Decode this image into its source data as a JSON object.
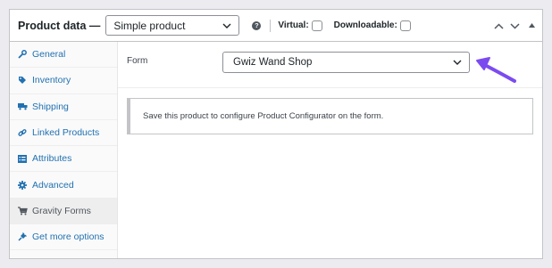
{
  "header": {
    "title": "Product data —",
    "product_type": "Simple product",
    "help_icon": "help-question-icon",
    "virtual_label": "Virtual:",
    "downloadable_label": "Downloadable:"
  },
  "sidebar": {
    "items": [
      {
        "label": "General",
        "icon": "wrench-icon"
      },
      {
        "label": "Inventory",
        "icon": "tag-icon"
      },
      {
        "label": "Shipping",
        "icon": "truck-icon"
      },
      {
        "label": "Linked Products",
        "icon": "link-icon"
      },
      {
        "label": "Attributes",
        "icon": "list-table-icon"
      },
      {
        "label": "Advanced",
        "icon": "gear-icon"
      },
      {
        "label": "Gravity Forms",
        "icon": "cart-icon"
      },
      {
        "label": "Get more options",
        "icon": "plugin-icon"
      }
    ],
    "active_index": 6
  },
  "main": {
    "form_label": "Form",
    "form_value": "Gwiz Wand Shop",
    "notice": "Save this product to configure Product Configurator on the form."
  },
  "colors": {
    "link": "#2271b1",
    "arrow": "#7b4bf0",
    "border": "#c3c4c7"
  }
}
